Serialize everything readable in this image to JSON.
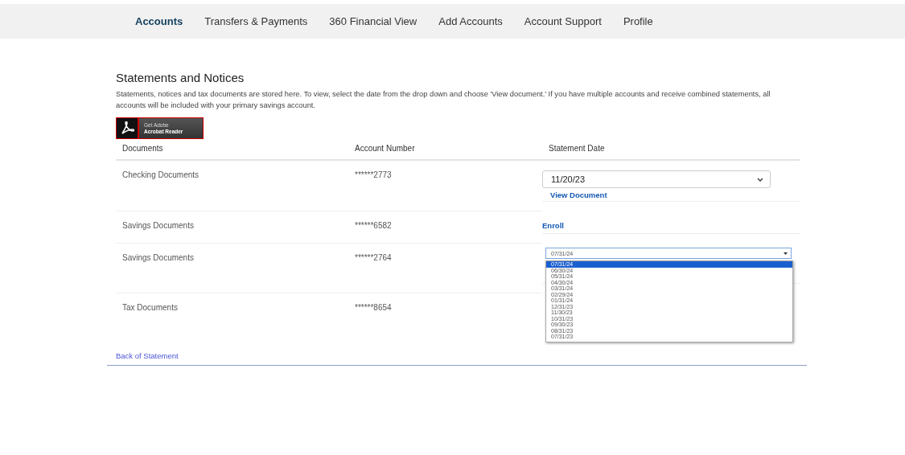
{
  "nav": {
    "items": [
      {
        "label": "Accounts",
        "selected": true
      },
      {
        "label": "Transfers & Payments",
        "selected": false
      },
      {
        "label": "360 Financial View",
        "selected": false
      },
      {
        "label": "Add Accounts",
        "selected": false
      },
      {
        "label": "Account Support",
        "selected": false
      },
      {
        "label": "Profile",
        "selected": false
      }
    ]
  },
  "page": {
    "title": "Statements and Notices",
    "intro": "Statements, notices and tax documents are stored here. To view, select the date from the drop down and choose 'View document.' If you have multiple accounts and receive combined statements, all accounts will be included with your primary savings account.",
    "adobe_badge": {
      "line_1": "Get Adobe",
      "line_2": "Acrobat Reader"
    }
  },
  "table": {
    "columns": [
      "Documents",
      "Account Number",
      "Statement Date"
    ],
    "rows": [
      {
        "document": "Checking Documents",
        "account": "******2773",
        "date": {
          "kind": "select",
          "value": "11/20/23",
          "link": "View Document"
        }
      },
      {
        "document": "Savings Documents",
        "account": "******6582",
        "date": {
          "kind": "link",
          "label": "Enroll"
        }
      },
      {
        "document": "Savings Documents",
        "account": "******2764",
        "date": {
          "kind": "open-select",
          "value": "07/31/24",
          "options": [
            {
              "label": "07/31/24",
              "selected": true
            },
            {
              "label": "06/30/24",
              "selected": false
            },
            {
              "label": "05/31/24",
              "selected": false
            },
            {
              "label": "04/30/24",
              "selected": false
            },
            {
              "label": "03/31/24",
              "selected": false
            },
            {
              "label": "02/29/24",
              "selected": false
            },
            {
              "label": "01/31/24",
              "selected": false
            },
            {
              "label": "12/31/23",
              "selected": false
            },
            {
              "label": "11/30/23",
              "selected": false
            },
            {
              "label": "10/31/23",
              "selected": false
            },
            {
              "label": "09/30/23",
              "selected": false
            },
            {
              "label": "08/31/23",
              "selected": false
            },
            {
              "label": "07/31/23",
              "selected": false
            }
          ]
        }
      },
      {
        "document": "Tax Documents",
        "account": "******8654"
      }
    ]
  },
  "back_link": "Back of Statement"
}
